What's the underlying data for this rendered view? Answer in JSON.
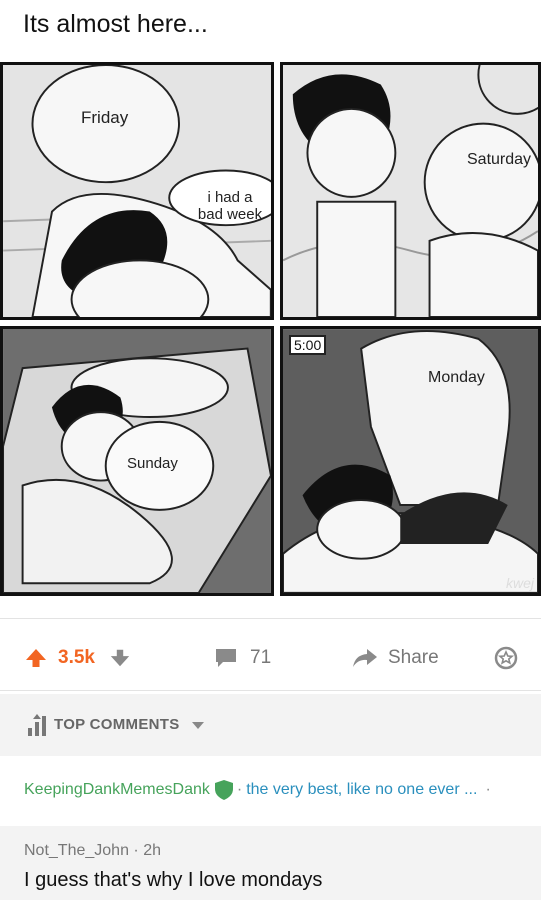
{
  "post": {
    "title": "Its almost here...",
    "panels": {
      "p1": {
        "label": "Friday",
        "bubble": "i had a bad week"
      },
      "p2": {
        "label": "Saturday"
      },
      "p3": {
        "label": "Sunday"
      },
      "p4": {
        "label": "Monday",
        "clock": "5:00",
        "watermark": "kwej"
      }
    }
  },
  "actions": {
    "votes": "3.5k",
    "comments": "71",
    "share": "Share",
    "icons": [
      "upvote-arrow-icon",
      "downvote-arrow-icon",
      "comment-bubble-icon",
      "share-arrow-icon",
      "award-icon"
    ],
    "upvote_color": "#f26522"
  },
  "top_comments": {
    "label": "TOP COMMENTS",
    "icon": "sort-bars-icon"
  },
  "flair_row": {
    "user": "KeepingDankMemesDank",
    "user_color": "#46a35b",
    "text": "the very best, like no one ever ...",
    "text_color": "#2a8fbd",
    "icon": "shield-icon"
  },
  "comment": {
    "author": "Not_The_John",
    "age": "2h",
    "text": "I guess that's why I love mondays"
  }
}
